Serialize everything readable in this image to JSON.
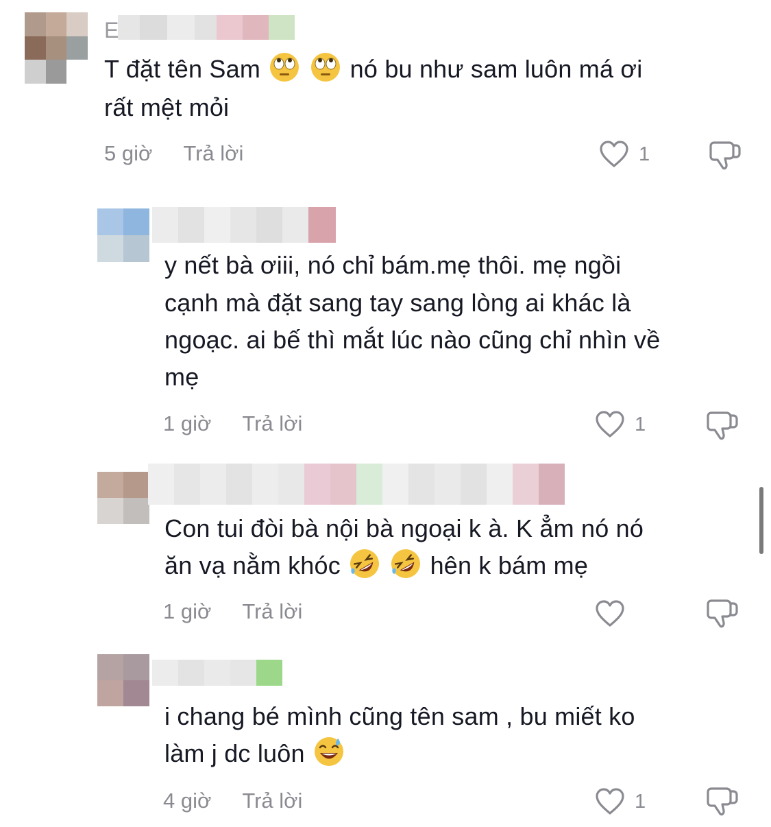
{
  "comments": [
    {
      "author_initial": "E",
      "line1_prefix": "T đặt tên Sam",
      "line1_suffix": "nó bu như sam luôn má ơi",
      "line2": "rất mệt mỏi",
      "time": "5 giờ",
      "reply_label": "Trả lời",
      "likes": "1",
      "emoji": "face-with-rolling-eyes"
    },
    {
      "lines": [
        "y nết bà ơiii, nó chỉ bám.mẹ thôi. mẹ ngồi",
        "cạnh mà đặt sang tay sang lòng ai khác là",
        "ngoạc. ai bế thì mắt lúc nào cũng chỉ nhìn về",
        "mẹ"
      ],
      "time": "1 giờ",
      "reply_label": "Trả lời",
      "likes": "1"
    },
    {
      "line1": "Con tui đòi bà nội bà ngoại k à. K ẳm nó nó",
      "line2_prefix": "ăn vạ nằm khóc",
      "line2_suffix": "hên k bám mẹ",
      "time": "1 giờ",
      "reply_label": "Trả lời",
      "likes": "",
      "emoji": "rolling-on-the-floor-laughing"
    },
    {
      "line1": "i chang bé mình cũng tên sam , bu miết ko",
      "line2_prefix": "làm j dc luôn",
      "time": "4 giờ",
      "reply_label": "Trả lời",
      "likes": "1",
      "emoji": "grinning-face-with-sweat"
    }
  ],
  "icons": {
    "like": "heart-outline-icon",
    "dislike": "thumbs-down-icon"
  },
  "colors": {
    "text": "#161823",
    "meta": "#8a8b91"
  }
}
